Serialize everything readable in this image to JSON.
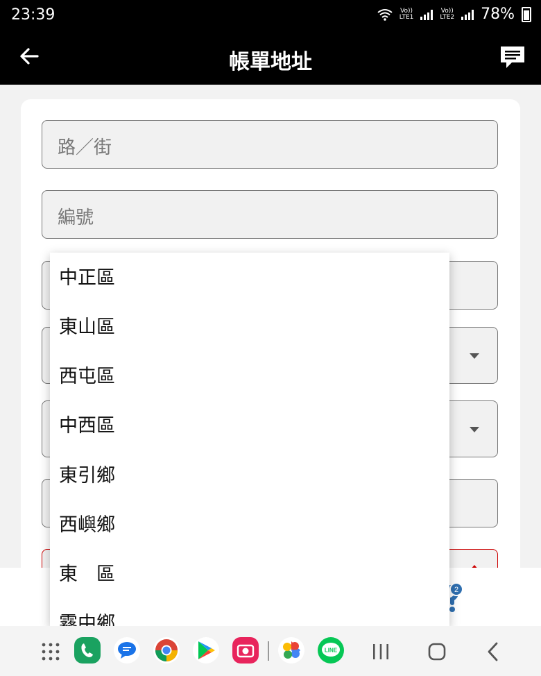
{
  "status_bar": {
    "time": "23:39",
    "sim1": "LTE1",
    "sim2": "LTE2",
    "volte": "Vo))",
    "battery": "78%"
  },
  "app_bar": {
    "title": "帳單地址"
  },
  "form": {
    "street_placeholder": "路／街",
    "number_placeholder": "編號"
  },
  "dropdown": {
    "options": [
      "中正區",
      "東山區",
      "西屯區",
      "中西區",
      "東引鄉",
      "西嶼鄉",
      "東　區",
      "霧中鄉"
    ]
  },
  "help_badge": "2",
  "colors": {
    "header": "#000000",
    "error_border": "#cc0000",
    "help_blue": "#2f6fb0"
  },
  "nav_icons": [
    "apps-grid-icon",
    "phone-icon",
    "messages-icon",
    "chrome-icon",
    "play-store-icon",
    "camera-icon",
    "photos-icon",
    "line-icon",
    "recents-icon",
    "home-icon",
    "back-icon"
  ]
}
